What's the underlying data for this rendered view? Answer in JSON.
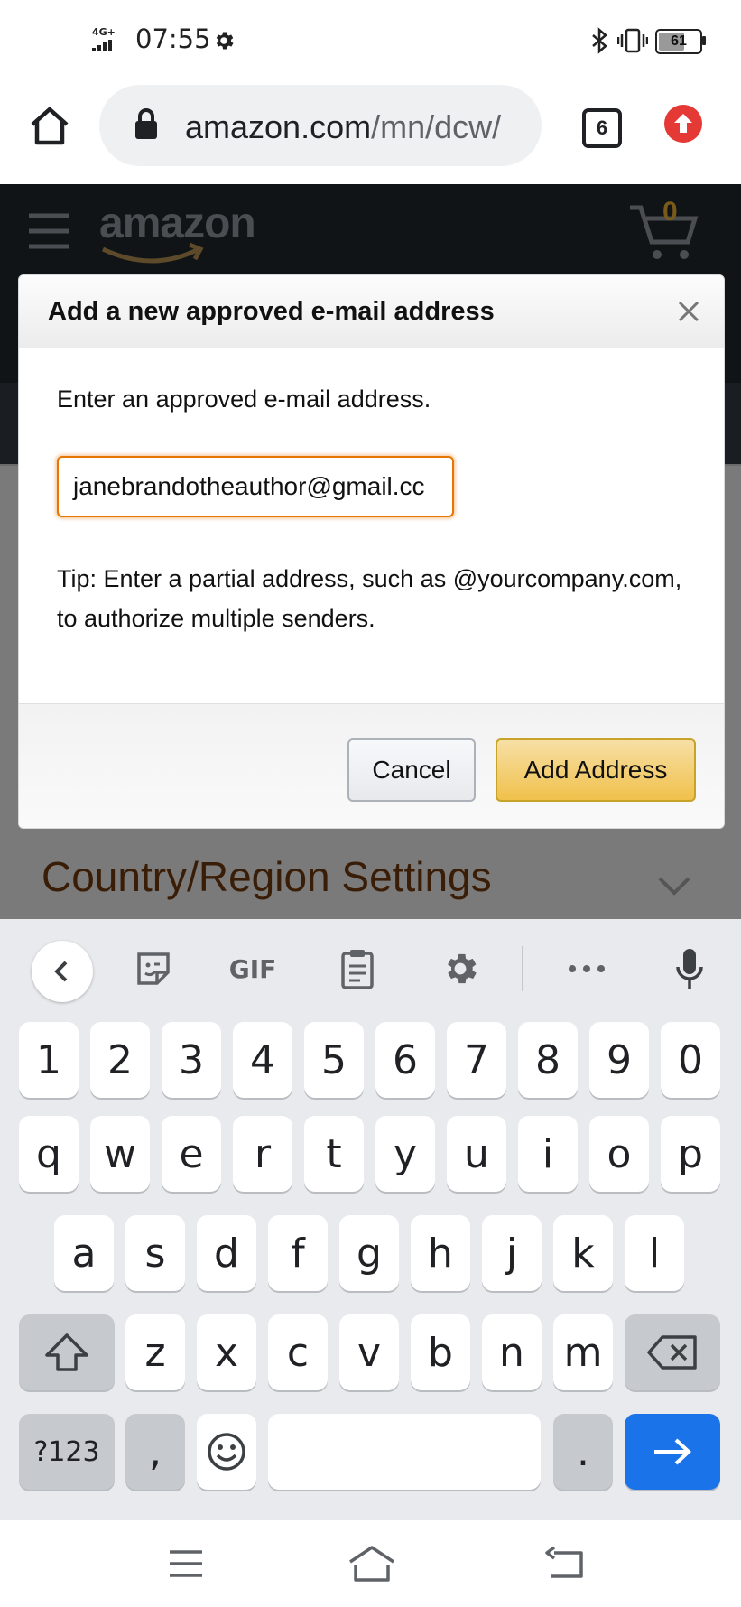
{
  "status_bar": {
    "network": "4G+",
    "time": "07:55",
    "battery": "61"
  },
  "browser": {
    "url_domain": "amazon.com",
    "url_path": "/mn/dcw/",
    "tab_count": "6",
    "icons": [
      "home-icon",
      "lock-icon",
      "tabs-icon",
      "update-icon"
    ]
  },
  "background_page": {
    "logo": "amazon",
    "cart_count": "0",
    "section_heading": "Country/Region Settings"
  },
  "dialog": {
    "title": "Add a new approved e-mail address",
    "prompt": "Enter an approved e-mail address.",
    "email_value": "janebrandotheauthor@gmail.cc",
    "tip": "Tip: Enter a partial address, such as @yourcompany.com, to authorize multiple senders.",
    "cancel_label": "Cancel",
    "add_label": "Add Address",
    "accent_color": "#f0c14b",
    "focus_color": "#e77600"
  },
  "keyboard": {
    "toolbar": {
      "gif_label": "GIF"
    },
    "row_numbers": [
      "1",
      "2",
      "3",
      "4",
      "5",
      "6",
      "7",
      "8",
      "9",
      "0"
    ],
    "row_1": [
      "q",
      "w",
      "e",
      "r",
      "t",
      "y",
      "u",
      "i",
      "o",
      "p"
    ],
    "row_2": [
      "a",
      "s",
      "d",
      "f",
      "g",
      "h",
      "j",
      "k",
      "l"
    ],
    "row_3": [
      "z",
      "x",
      "c",
      "v",
      "b",
      "n",
      "m"
    ],
    "symbols_label": "?123",
    "comma": ",",
    "period": ".",
    "enter_color": "#1a73e8"
  }
}
